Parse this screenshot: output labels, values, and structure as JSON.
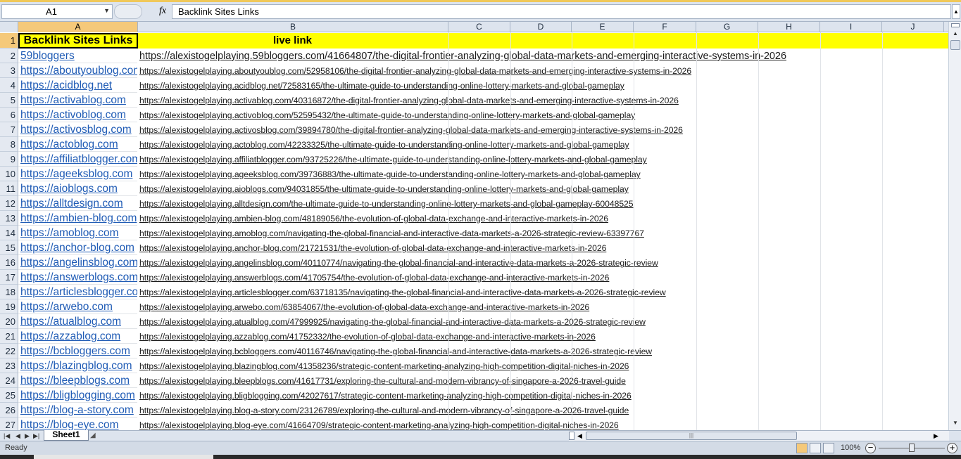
{
  "formula_bar": {
    "name_box": "A1",
    "fx": "fx",
    "formula": "Backlink Sites Links"
  },
  "columns": [
    "A",
    "B",
    "C",
    "D",
    "E",
    "F",
    "G",
    "H",
    "I",
    "J"
  ],
  "header_row": {
    "row": "1",
    "a": "Backlink Sites Links",
    "b": "live link"
  },
  "rows": [
    {
      "n": "2",
      "a": "59bloggers",
      "b": "https://alexistogelplaying.59bloggers.com/41664807/the-digital-frontier-analyzing-global-data-markets-and-emerging-interactive-systems-in-2026"
    },
    {
      "n": "3",
      "a": "https://aboutyoublog.com",
      "b": "https://alexistogelplaying.aboutyoublog.com/52958106/the-digital-frontier-analyzing-global-data-markets-and-emerging-interactive-systems-in-2026"
    },
    {
      "n": "4",
      "a": "https://acidblog.net",
      "b": "https://alexistogelplaying.acidblog.net/72583165/the-ultimate-guide-to-understanding-online-lottery-markets-and-global-gameplay"
    },
    {
      "n": "5",
      "a": "https://activablog.com",
      "b": "https://alexistogelplaying.activablog.com/40316872/the-digital-frontier-analyzing-global-data-markets-and-emerging-interactive-systems-in-2026"
    },
    {
      "n": "6",
      "a": "https://activoblog.com",
      "b": "https://alexistogelplaying.activoblog.com/52595432/the-ultimate-guide-to-understanding-online-lottery-markets-and-global-gameplay"
    },
    {
      "n": "7",
      "a": "https://activosblog.com",
      "b": "https://alexistogelplaying.activosblog.com/39894780/the-digital-frontier-analyzing-global-data-markets-and-emerging-interactive-systems-in-2026"
    },
    {
      "n": "8",
      "a": "https://actoblog.com",
      "b": "https://alexistogelplaying.actoblog.com/42233325/the-ultimate-guide-to-understanding-online-lottery-markets-and-global-gameplay"
    },
    {
      "n": "9",
      "a": "https://affiliatblogger.com",
      "b": "https://alexistogelplaying.affiliatblogger.com/93725226/the-ultimate-guide-to-understanding-online-lottery-markets-and-global-gameplay"
    },
    {
      "n": "10",
      "a": "https://ageeksblog.com",
      "b": "https://alexistogelplaying.ageeksblog.com/39736883/the-ultimate-guide-to-understanding-online-lottery-markets-and-global-gameplay"
    },
    {
      "n": "11",
      "a": "https://aioblogs.com",
      "b": "https://alexistogelplaying.aioblogs.com/94031855/the-ultimate-guide-to-understanding-online-lottery-markets-and-global-gameplay"
    },
    {
      "n": "12",
      "a": "https://alltdesign.com",
      "b": "https://alexistogelplaying.alltdesign.com/the-ultimate-guide-to-understanding-online-lottery-markets-and-global-gameplay-60048525"
    },
    {
      "n": "13",
      "a": "https://ambien-blog.com",
      "b": "https://alexistogelplaying.ambien-blog.com/48189056/the-evolution-of-global-data-exchange-and-interactive-markets-in-2026"
    },
    {
      "n": "14",
      "a": "https://amoblog.com",
      "b": "https://alexistogelplaying.amoblog.com/navigating-the-global-financial-and-interactive-data-markets-a-2026-strategic-review-63397767"
    },
    {
      "n": "15",
      "a": "https://anchor-blog.com",
      "b": "https://alexistogelplaying.anchor-blog.com/21721531/the-evolution-of-global-data-exchange-and-interactive-markets-in-2026"
    },
    {
      "n": "16",
      "a": "https://angelinsblog.com",
      "b": "https://alexistogelplaying.angelinsblog.com/40110774/navigating-the-global-financial-and-interactive-data-markets-a-2026-strategic-review"
    },
    {
      "n": "17",
      "a": "https://answerblogs.com",
      "b": "https://alexistogelplaying.answerblogs.com/41705754/the-evolution-of-global-data-exchange-and-interactive-markets-in-2026"
    },
    {
      "n": "18",
      "a": "https://articlesblogger.com",
      "b": "https://alexistogelplaying.articlesblogger.com/63718135/navigating-the-global-financial-and-interactive-data-markets-a-2026-strategic-review"
    },
    {
      "n": "19",
      "a": "https://arwebo.com",
      "b": "https://alexistogelplaying.arwebo.com/63854067/the-evolution-of-global-data-exchange-and-interactive-markets-in-2026"
    },
    {
      "n": "20",
      "a": "https://atualblog.com",
      "b": "https://alexistogelplaying.atualblog.com/47999925/navigating-the-global-financial-and-interactive-data-markets-a-2026-strategic-review"
    },
    {
      "n": "21",
      "a": "https://azzablog.com",
      "b": "https://alexistogelplaying.azzablog.com/41752332/the-evolution-of-global-data-exchange-and-interactive-markets-in-2026"
    },
    {
      "n": "22",
      "a": "https://bcbloggers.com",
      "b": "https://alexistogelplaying.bcbloggers.com/40116746/navigating-the-global-financial-and-interactive-data-markets-a-2026-strategic-review"
    },
    {
      "n": "23",
      "a": "https://blazingblog.com",
      "b": "https://alexistogelplaying.blazingblog.com/41358236/strategic-content-marketing-analyzing-high-competition-digital-niches-in-2026"
    },
    {
      "n": "24",
      "a": "https://bleepblogs.com",
      "b": "https://alexistogelplaying.bleepblogs.com/41617731/exploring-the-cultural-and-modern-vibrancy-of-singapore-a-2026-travel-guide"
    },
    {
      "n": "25",
      "a": "https://bligblogging.com",
      "b": "https://alexistogelplaying.bligblogging.com/42027617/strategic-content-marketing-analyzing-high-competition-digital-niches-in-2026"
    },
    {
      "n": "26",
      "a": "https://blog-a-story.com",
      "b": "https://alexistogelplaying.blog-a-story.com/23126789/exploring-the-cultural-and-modern-vibrancy-of-singapore-a-2026-travel-guide"
    },
    {
      "n": "27",
      "a": "https://blog-eye.com",
      "b": "https://alexistogelplaying.blog-eye.com/41664709/strategic-content-marketing-analyzing-high-competition-digital-niches-in-2026"
    }
  ],
  "sheet_tabs": {
    "active": "Sheet1"
  },
  "status_bar": {
    "status": "Ready",
    "zoom": "100%"
  },
  "colors": {
    "header_fill": "#ffff00",
    "link_blue": "#1f5bb5",
    "chrome": "#dde4ee",
    "selected_header": "#f5c97a"
  },
  "icons": {
    "name_box_dropdown": "chevron-down-icon",
    "fx": "function-icon",
    "view_normal": "normal-view-icon",
    "view_layout": "page-layout-icon",
    "view_break": "page-break-icon"
  }
}
